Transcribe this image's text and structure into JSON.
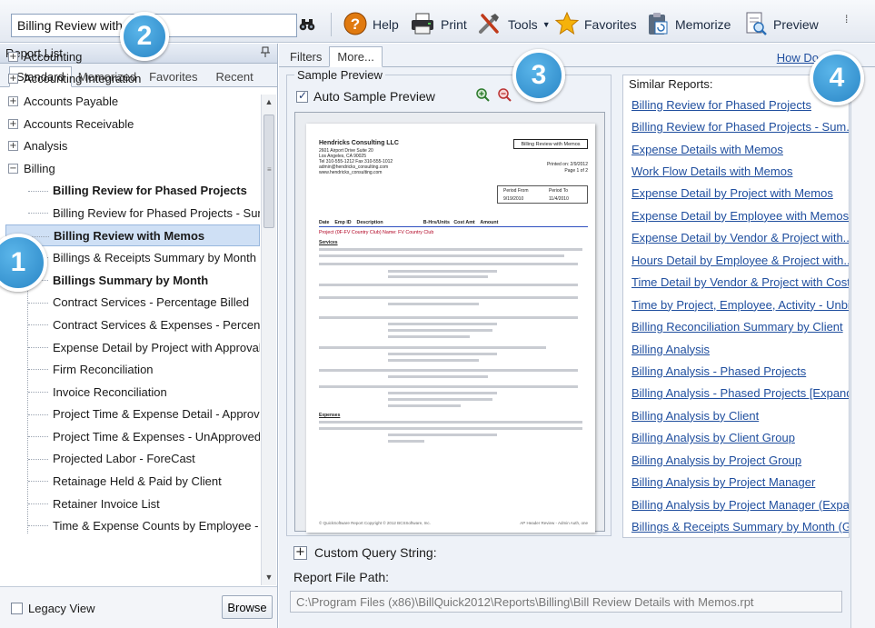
{
  "toolbar": {
    "search_value": "Billing Review with",
    "binoculars_icon": "binoculars-icon",
    "help": "Help",
    "print": "Print",
    "tools": "Tools",
    "favorites": "Favorites",
    "memorize": "Memorize",
    "preview": "Preview"
  },
  "callouts": {
    "one": "1",
    "two": "2",
    "three": "3",
    "four": "4"
  },
  "left_panel": {
    "title": "Report List",
    "pin_icon": "pin-icon",
    "tabs": [
      "Standard",
      "Memorized",
      "Favorites",
      "Recent"
    ],
    "categories": {
      "accounting": "Accounting",
      "accounting_integration": "Accounting Integration",
      "accounts_payable": "Accounts Payable",
      "accounts_receivable": "Accounts Receivable",
      "analysis": "Analysis",
      "billing": "Billing"
    },
    "billing_children": [
      "Billing Review for Phased Projects",
      "Billing Review for Phased Projects - Sum",
      "Billing Review with Memos",
      "Billings & Receipts Summary by Month (",
      "Billings Summary by Month",
      "Contract Services - Percentage Billed",
      "Contract Services & Expenses - Percenta",
      "Expense Detail by Project with Approval",
      "Firm Reconciliation",
      "Invoice Reconciliation",
      "Project Time & Expense Detail - Approve",
      "Project Time & Expenses - UnApproved",
      "Projected Labor - ForeCast",
      "Retainage Held & Paid by Client",
      "Retainer Invoice List",
      "Time & Expense Counts by Employee - U"
    ],
    "legacy_view": "Legacy View",
    "browse": "Browse"
  },
  "right_panel": {
    "tabs": [
      "Filters",
      "More..."
    ],
    "how_do": "How Do",
    "sample_preview": "Sample Preview",
    "auto_sample_preview": "Auto Sample Preview",
    "custom_query": "Custom Query String:",
    "report_file_path_label": "Report File Path:",
    "report_file_path": "C:\\Program Files (x86)\\BillQuick2012\\Reports\\Billing\\Bill Review Details with Memos.rpt",
    "similar_title": "Similar Reports:",
    "similar_reports": [
      "Billing Review for Phased Projects",
      "Billing Review for Phased Projects - Sum...",
      "Expense Details with Memos",
      "Work Flow Details with Memos",
      "Expense Detail by Project with Memos",
      "Expense Detail by Employee with Memos",
      "Expense Detail by Vendor & Project with...",
      "Hours Detail by Employee & Project with...",
      "Time Detail by Vendor & Project with Cost...",
      "Time by Project, Employee, Activity - Unbil...",
      "Billing Reconciliation Summary by Client",
      "Billing Analysis",
      "Billing Analysis - Phased Projects",
      "Billing Analysis - Phased Projects [Expand...",
      "Billing Analysis by Client",
      "Billing Analysis by Client Group",
      "Billing Analysis by Project Group",
      "Billing Analysis by Project Manager",
      "Billing Analysis by Project Manager (Expa...",
      "Billings & Receipts Summary by Month (G..."
    ]
  },
  "preview_doc": {
    "company": "Hendricks Consulting LLC",
    "address": "2601 Airport Drive Suite 20\nLos Angeles, CA 90025\nTel 310-555-1212 Fax 310-555-1012\nadmin@hendricks_consulting.com\nwww.hendricks_consulting.com",
    "title_box": "Billing Review with Memos",
    "printed_on": "Printed on: 2/9/2012",
    "page": "Page 1 of 2",
    "period_from_label": "Period From",
    "period_to_label": "Period To",
    "period_from": "9/19/2010",
    "period_to": "11/4/2010",
    "columns": "Date    Emp ID    Description                              B-Hrs/Units   Cost Amt    Amount",
    "project": "Project   (0F-FV Country Club) Name: FV Country Club",
    "section_services": "Services",
    "section_expenses": "Expenses",
    "footer_left": "© QuickSoftware Report Copyright © 2012 BCSSoftware, Inc.",
    "footer_right": "AP Header Review - Admin Auth, one"
  }
}
